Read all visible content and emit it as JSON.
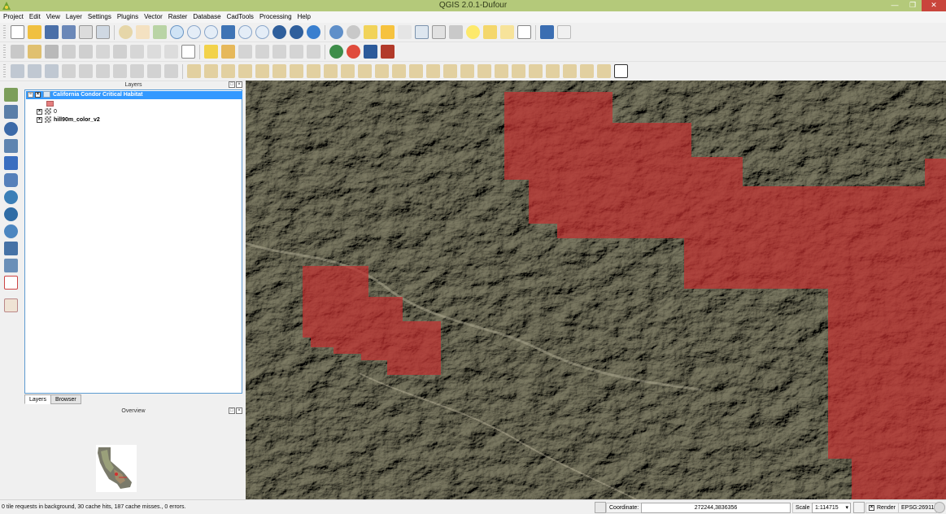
{
  "window": {
    "title": "QGIS 2.0.1-Dufour",
    "app_icon": "qgis-icon",
    "minimize_icon": "minimize-icon",
    "maximize_icon": "maximize-icon",
    "close_icon": "close-icon",
    "accent_color": "#b4c97a",
    "close_color": "#c9453c"
  },
  "menu": [
    "Project",
    "Edit",
    "View",
    "Layer",
    "Settings",
    "Plugins",
    "Vector",
    "Raster",
    "Database",
    "CadTools",
    "Processing",
    "Help"
  ],
  "layers_panel": {
    "title": "Layers",
    "layers": [
      {
        "name": "California Condor Critical Habitat",
        "checked": true,
        "selected": true,
        "symbol_color": "#e47e7e"
      },
      {
        "name": "0",
        "checked": true,
        "selected": false
      },
      {
        "name": "hill90m_color_v2",
        "checked": true,
        "selected": false
      }
    ],
    "tabs": [
      "Layers",
      "Browser"
    ],
    "active_tab": "Layers"
  },
  "overview_panel": {
    "title": "Overview"
  },
  "map": {
    "habitat_fill_color": "#c23030"
  },
  "statusbar": {
    "message": "0 tile requests in background, 30 cache hits, 187 cache misses., 0 errors.",
    "coordinate_label": "Coordinate:",
    "coordinate_value": "272244,3836356",
    "scale_label": "Scale",
    "scale_value": "1:114715",
    "render_label": "Render",
    "render_checked": true,
    "crs": "EPSG:26911"
  }
}
